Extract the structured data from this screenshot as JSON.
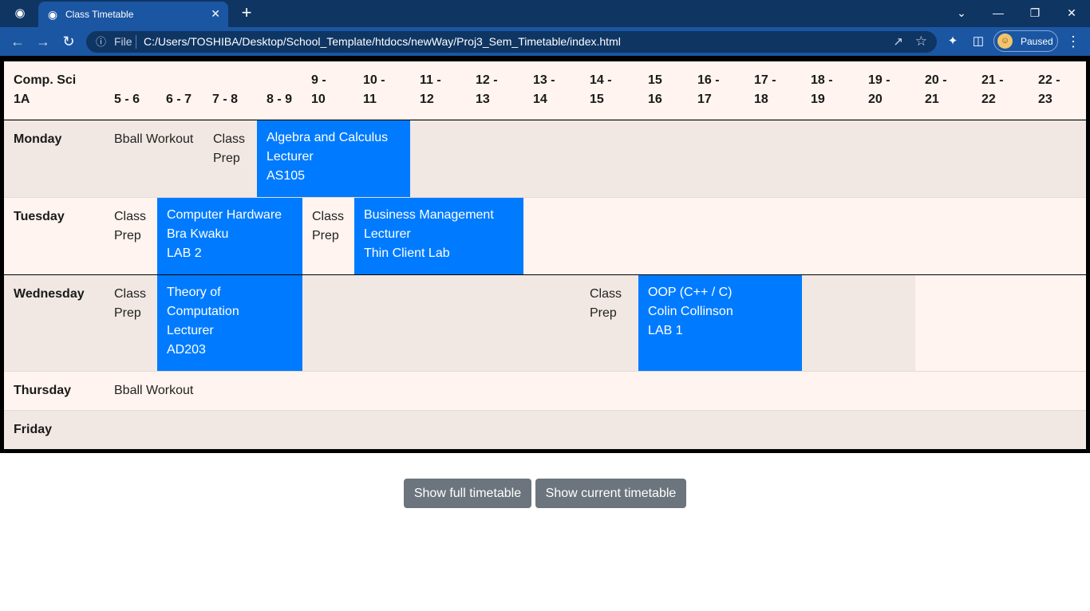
{
  "browser": {
    "tab_title": "Class Timetable",
    "file_label": "File",
    "url": "C:/Users/TOSHIBA/Desktop/School_Template/htdocs/newWay/Proj3_Sem_Timetable/index.html",
    "profile_status": "Paused"
  },
  "timetable": {
    "corner": "Comp. Sci\n1A",
    "hours": [
      "5 - 6",
      "6 - 7",
      "7 - 8",
      "8 - 9",
      "9 -\n10",
      "10 -\n11",
      "11 -\n12",
      "12 -\n13",
      "13 -\n14",
      "14 -\n15",
      "15\n16",
      "16 -\n17",
      "17 -\n18",
      "18 -\n19",
      "19 -\n20",
      "20 -\n21",
      "21 -\n22",
      "22 -\n23"
    ],
    "days": [
      "Monday",
      "Tuesday",
      "Wednesday",
      "Thursday",
      "Friday"
    ],
    "monday": {
      "bball": "Bball Workout",
      "prep": "Class\nPrep",
      "algebra": "Algebra and Calculus\nLecturer\nAS105"
    },
    "tuesday": {
      "prep1": "Class\nPrep",
      "hardware": "Computer Hardware\nBra Kwaku\nLAB 2",
      "prep2": "Class\nPrep",
      "business": "Business Management\nLecturer\nThin Client Lab"
    },
    "wednesday": {
      "prep1": "Class\nPrep",
      "theory": "Theory of\nComputation\nLecturer\nAD203",
      "prep2": "Class\nPrep",
      "oop": "OOP (C++ / C)\nColin Collinson\nLAB 1"
    },
    "thursday": {
      "bball": "Bball Workout"
    }
  },
  "buttons": {
    "full": "Show full timetable",
    "current": "Show current timetable"
  },
  "colors": {
    "slot": "#007bff",
    "row_light": "#fff4ef",
    "row_dark": "#f1e8e3",
    "button": "#6c757d",
    "tabbar": "#0f3563",
    "toolbar": "#1b56a3"
  }
}
